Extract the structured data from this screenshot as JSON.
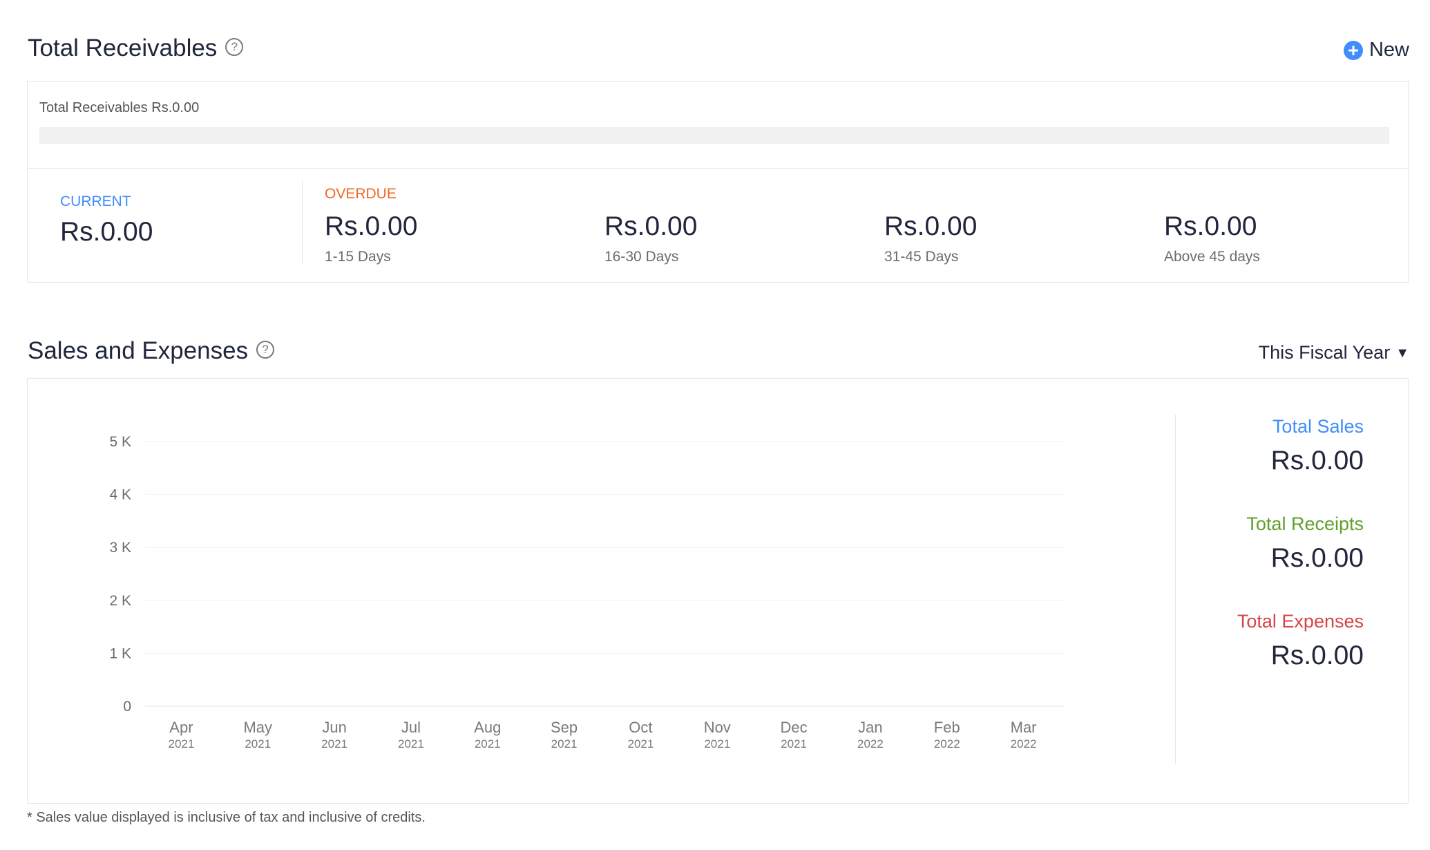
{
  "receivables": {
    "title": "Total Receivables",
    "help_icon": "?",
    "new_button": {
      "icon": "+",
      "label": "New"
    },
    "summary_label": "Total Receivables Rs.0.00",
    "progress_fraction": 0,
    "current": {
      "label": "CURRENT",
      "value": "Rs.0.00"
    },
    "overdue_label": "OVERDUE",
    "buckets": [
      {
        "value": "Rs.0.00",
        "label": "1-15 Days"
      },
      {
        "value": "Rs.0.00",
        "label": "16-30 Days"
      },
      {
        "value": "Rs.0.00",
        "label": "31-45 Days"
      },
      {
        "value": "Rs.0.00",
        "label": "Above 45 days"
      }
    ]
  },
  "sales": {
    "title": "Sales and Expenses",
    "help_icon": "?",
    "period_select": "This Fiscal Year",
    "totals": [
      {
        "name": "Total Sales",
        "value": "Rs.0.00",
        "color": "#408dfb"
      },
      {
        "name": "Total Receipts",
        "value": "Rs.0.00",
        "color": "#5fa02d"
      },
      {
        "name": "Total Expenses",
        "value": "Rs.0.00",
        "color": "#d64545"
      }
    ],
    "footnote": "* Sales value displayed is inclusive of tax and inclusive of credits."
  },
  "chart_data": {
    "type": "bar",
    "y_tick_labels": [
      "5 K",
      "4 K",
      "3 K",
      "2 K",
      "1 K",
      "0"
    ],
    "ylim": [
      0,
      5000
    ],
    "grid": true,
    "categories": [
      {
        "month": "Apr",
        "year": "2021"
      },
      {
        "month": "May",
        "year": "2021"
      },
      {
        "month": "Jun",
        "year": "2021"
      },
      {
        "month": "Jul",
        "year": "2021"
      },
      {
        "month": "Aug",
        "year": "2021"
      },
      {
        "month": "Sep",
        "year": "2021"
      },
      {
        "month": "Oct",
        "year": "2021"
      },
      {
        "month": "Nov",
        "year": "2021"
      },
      {
        "month": "Dec",
        "year": "2021"
      },
      {
        "month": "Jan",
        "year": "2022"
      },
      {
        "month": "Feb",
        "year": "2022"
      },
      {
        "month": "Mar",
        "year": "2022"
      }
    ],
    "series": [
      {
        "values": [
          0,
          0,
          0,
          0,
          0,
          0,
          0,
          0,
          0,
          0,
          0,
          0
        ]
      }
    ]
  }
}
